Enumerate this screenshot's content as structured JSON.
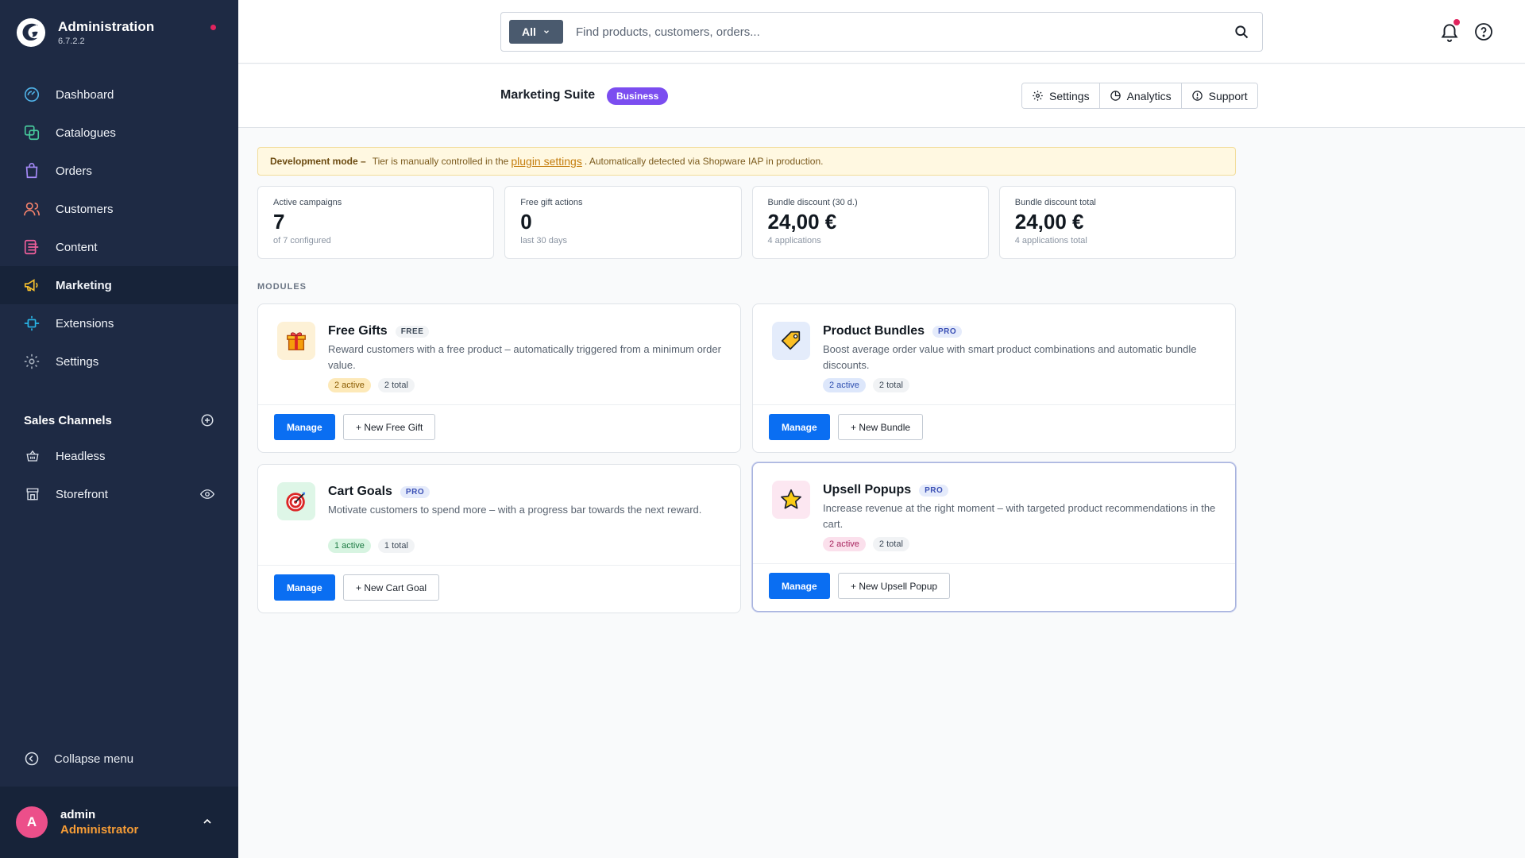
{
  "app": {
    "title": "Administration",
    "version": "6.7.2.2"
  },
  "nav": [
    {
      "label": "Dashboard",
      "icon": "dashboard-icon",
      "color": "#4fb0e5"
    },
    {
      "label": "Catalogues",
      "icon": "catalogues-icon",
      "color": "#47c99c"
    },
    {
      "label": "Orders",
      "icon": "orders-icon",
      "color": "#a78bfa"
    },
    {
      "label": "Customers",
      "icon": "customers-icon",
      "color": "#f0806b"
    },
    {
      "label": "Content",
      "icon": "content-icon",
      "color": "#f05f9b"
    },
    {
      "label": "Marketing",
      "icon": "marketing-icon",
      "color": "#f7c02d",
      "active": true
    },
    {
      "label": "Extensions",
      "icon": "extensions-icon",
      "color": "#29b6e8"
    },
    {
      "label": "Settings",
      "icon": "settings-icon",
      "color": "#a0aab8"
    }
  ],
  "sales_channels": {
    "title": "Sales Channels",
    "items": [
      {
        "label": "Headless",
        "icon": "basket-icon"
      },
      {
        "label": "Storefront",
        "icon": "storefront-icon"
      }
    ]
  },
  "collapse_label": "Collapse menu",
  "user": {
    "initial": "A",
    "name": "admin",
    "role": "Administrator"
  },
  "search": {
    "scope": "All",
    "placeholder": "Find products, customers, orders..."
  },
  "header": {
    "title": "Marketing Suite",
    "tier": "Business",
    "buttons": {
      "settings": "Settings",
      "analytics": "Analytics",
      "support": "Support"
    }
  },
  "dev_banner": {
    "strong": "Development mode –",
    "text_before": "Tier is manually controlled in the",
    "link": "plugin settings",
    "text_after": ". Automatically detected via Shopware IAP in production."
  },
  "stats": [
    {
      "label": "Active campaigns",
      "value": "7",
      "sub": "of 7 configured"
    },
    {
      "label": "Free gift actions",
      "value": "0",
      "sub": "last 30 days"
    },
    {
      "label": "Bundle discount (30 d.)",
      "value": "24,00 €",
      "sub": "4 applications"
    },
    {
      "label": "Bundle discount total",
      "value": "24,00 €",
      "sub": "4 applications total"
    }
  ],
  "modules_label": "MODULES",
  "modules": [
    {
      "title": "Free Gifts",
      "tag": "FREE",
      "desc": "Reward customers with a free product – automatically triggered from a minimum order value.",
      "active": "2 active",
      "total": "2 total",
      "manage": "Manage",
      "new": "+ New Free Gift",
      "icon": "gift-icon",
      "icon_bg": "#fdf1d6",
      "active_bg": "#fde9b8",
      "active_fg": "#8a5b00"
    },
    {
      "title": "Product Bundles",
      "tag": "PRO",
      "desc": "Boost average order value with smart product combinations and automatic bundle discounts.",
      "active": "2 active",
      "total": "2 total",
      "manage": "Manage",
      "new": "+ New Bundle",
      "icon": "tag-icon",
      "icon_bg": "#e4ecfb",
      "active_bg": "#dde7fb",
      "active_fg": "#2e4fb0"
    },
    {
      "title": "Cart Goals",
      "tag": "PRO",
      "desc": "Motivate customers to spend more – with a progress bar towards the next reward.",
      "active": "1 active",
      "total": "1 total",
      "manage": "Manage",
      "new": "+ New Cart Goal",
      "icon": "target-icon",
      "icon_bg": "#def6e7",
      "active_bg": "#d7f4e1",
      "active_fg": "#1d7a43"
    },
    {
      "title": "Upsell Popups",
      "tag": "PRO",
      "desc": "Increase revenue at the right moment – with targeted product recommendations in the cart.",
      "active": "2 active",
      "total": "2 total",
      "manage": "Manage",
      "new": "+ New Upsell Popup",
      "icon": "star-icon",
      "icon_bg": "#fce7f1",
      "active_bg": "#fbe0ec",
      "active_fg": "#a8245e"
    }
  ]
}
